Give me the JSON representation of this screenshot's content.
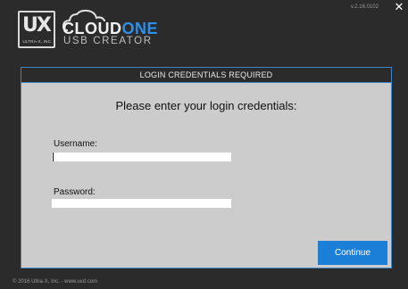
{
  "app": {
    "logo_text": "UX",
    "logo_subtext": "ULTRA-X, INC.",
    "brand_name_part1": "CLOUD",
    "brand_name_accent": "ONE",
    "brand_subtitle": "USB CREATOR",
    "version": "v.2.16.0102",
    "close_glyph": "✕"
  },
  "panel": {
    "header": "LOGIN CREDENTIALS REQUIRED",
    "prompt": "Please enter your login credentials:",
    "username_label": "Username:",
    "username_value": "",
    "password_label": "Password:",
    "password_value": "",
    "continue_label": "Continue"
  },
  "footer": {
    "text": "© 2016 Ultra-X, Inc. - www.uxd.com"
  },
  "colors": {
    "background": "#2b2b2b",
    "panel": "#cccccc",
    "accent": "#1b7fd8",
    "border": "#3e85c8"
  }
}
